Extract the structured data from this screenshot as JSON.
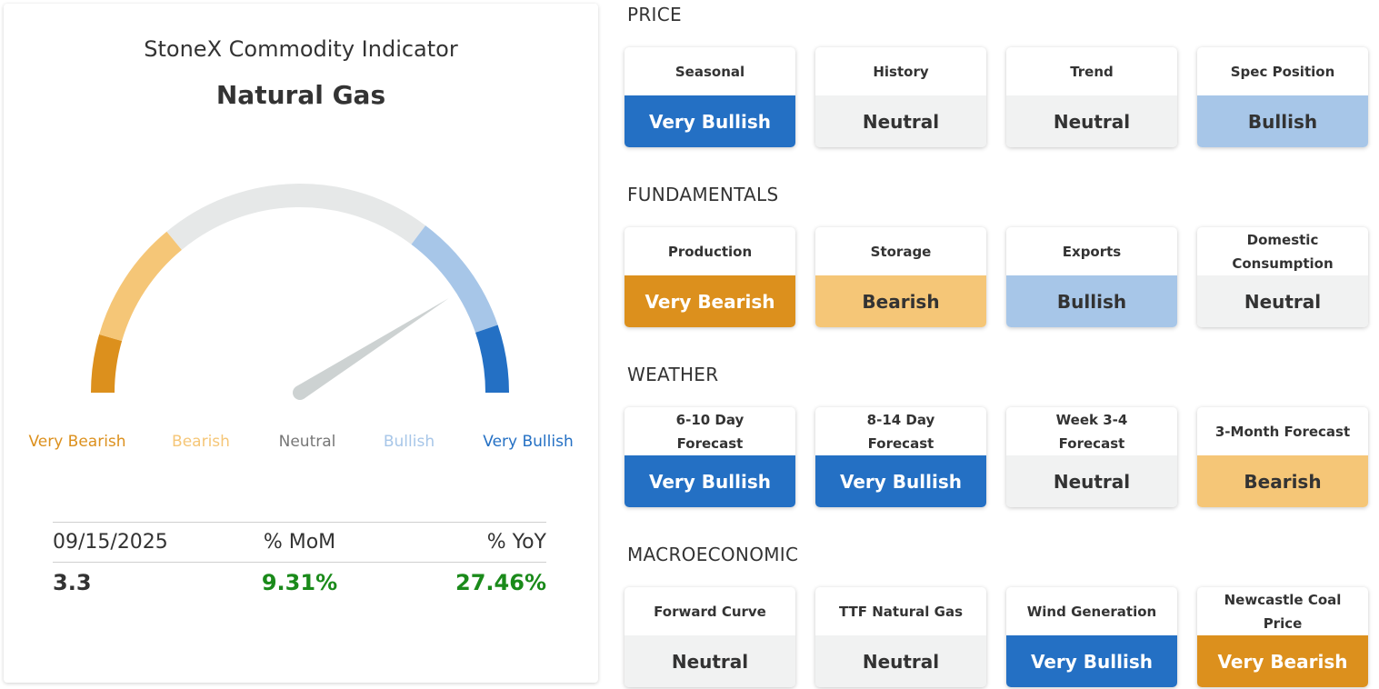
{
  "indicator": {
    "title": "StoneX Commodity Indicator",
    "commodity": "Natural Gas",
    "gauge_value": 0.82
  },
  "gauge_labels": [
    {
      "text": "Very Bearish",
      "color": "#dc901d"
    },
    {
      "text": "Bearish",
      "color": "#f5c677"
    },
    {
      "text": "Neutral",
      "color": "#777777"
    },
    {
      "text": "Bullish",
      "color": "#a7c6e8"
    },
    {
      "text": "Very Bullish",
      "color": "#2470c4"
    }
  ],
  "stats": {
    "date": "09/15/2025",
    "mom_label": "% MoM",
    "yoy_label": "% YoY",
    "value": "3.3",
    "mom": "9.31%",
    "yoy": "27.46%"
  },
  "sections": [
    {
      "title": "PRICE",
      "cards": [
        {
          "label": "Seasonal",
          "value": "Very Bullish",
          "state": "very-bullish"
        },
        {
          "label": "History",
          "value": "Neutral",
          "state": "neutral"
        },
        {
          "label": "Trend",
          "value": "Neutral",
          "state": "neutral"
        },
        {
          "label": "Spec Position",
          "value": "Bullish",
          "state": "bullish"
        }
      ]
    },
    {
      "title": "FUNDAMENTALS",
      "cards": [
        {
          "label": "Production",
          "value": "Very Bearish",
          "state": "very-bearish"
        },
        {
          "label": "Storage",
          "value": "Bearish",
          "state": "bearish"
        },
        {
          "label": "Exports",
          "value": "Bullish",
          "state": "bullish"
        },
        {
          "label": "Domestic Consumption",
          "value": "Neutral",
          "state": "neutral"
        }
      ]
    },
    {
      "title": "WEATHER",
      "cards": [
        {
          "label": "6-10 Day Forecast",
          "value": "Very Bullish",
          "state": "very-bullish"
        },
        {
          "label": "8-14 Day Forecast",
          "value": "Very Bullish",
          "state": "very-bullish"
        },
        {
          "label": "Week 3-4 Forecast",
          "value": "Neutral",
          "state": "neutral"
        },
        {
          "label": "3-Month Forecast",
          "value": "Bearish",
          "state": "bearish"
        }
      ]
    },
    {
      "title": "MACROECONOMIC",
      "cards": [
        {
          "label": "Forward Curve",
          "value": "Neutral",
          "state": "neutral"
        },
        {
          "label": "TTF Natural Gas",
          "value": "Neutral",
          "state": "neutral"
        },
        {
          "label": "Wind Generation",
          "value": "Very Bullish",
          "state": "very-bullish"
        },
        {
          "label": "Newcastle Coal Price",
          "value": "Very Bearish",
          "state": "very-bearish"
        }
      ]
    }
  ],
  "colors": {
    "very_bearish": "#dc901d",
    "bearish": "#f5c677",
    "neutral": "#e6e8e8",
    "bullish": "#a7c6e8",
    "very_bullish": "#2470c4",
    "needle": "#cdd2d2",
    "positive": "#1a8a1a"
  }
}
